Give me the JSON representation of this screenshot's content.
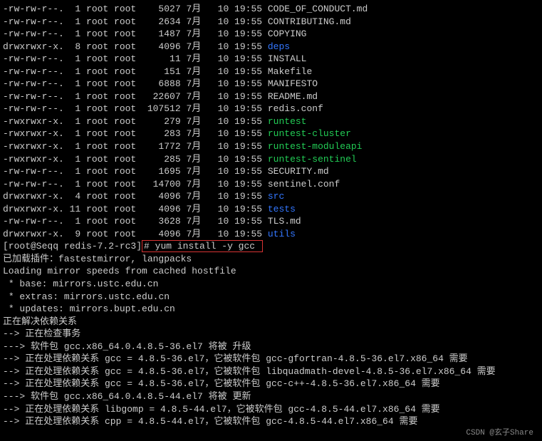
{
  "ls": [
    {
      "perm": "-rw-rw-r--.",
      "n": "1",
      "u": "root",
      "g": "root",
      "size": "5027",
      "mo": "7月",
      "d": "10",
      "t": "19:55",
      "name": "CODE_OF_CONDUCT.md",
      "cls": ""
    },
    {
      "perm": "-rw-rw-r--.",
      "n": "1",
      "u": "root",
      "g": "root",
      "size": "2634",
      "mo": "7月",
      "d": "10",
      "t": "19:55",
      "name": "CONTRIBUTING.md",
      "cls": ""
    },
    {
      "perm": "-rw-rw-r--.",
      "n": "1",
      "u": "root",
      "g": "root",
      "size": "1487",
      "mo": "7月",
      "d": "10",
      "t": "19:55",
      "name": "COPYING",
      "cls": ""
    },
    {
      "perm": "drwxrwxr-x.",
      "n": "8",
      "u": "root",
      "g": "root",
      "size": "4096",
      "mo": "7月",
      "d": "10",
      "t": "19:55",
      "name": "deps",
      "cls": "blue"
    },
    {
      "perm": "-rw-rw-r--.",
      "n": "1",
      "u": "root",
      "g": "root",
      "size": "11",
      "mo": "7月",
      "d": "10",
      "t": "19:55",
      "name": "INSTALL",
      "cls": ""
    },
    {
      "perm": "-rw-rw-r--.",
      "n": "1",
      "u": "root",
      "g": "root",
      "size": "151",
      "mo": "7月",
      "d": "10",
      "t": "19:55",
      "name": "Makefile",
      "cls": ""
    },
    {
      "perm": "-rw-rw-r--.",
      "n": "1",
      "u": "root",
      "g": "root",
      "size": "6888",
      "mo": "7月",
      "d": "10",
      "t": "19:55",
      "name": "MANIFESTO",
      "cls": ""
    },
    {
      "perm": "-rw-rw-r--.",
      "n": "1",
      "u": "root",
      "g": "root",
      "size": "22607",
      "mo": "7月",
      "d": "10",
      "t": "19:55",
      "name": "README.md",
      "cls": ""
    },
    {
      "perm": "-rw-rw-r--.",
      "n": "1",
      "u": "root",
      "g": "root",
      "size": "107512",
      "mo": "7月",
      "d": "10",
      "t": "19:55",
      "name": "redis.conf",
      "cls": ""
    },
    {
      "perm": "-rwxrwxr-x.",
      "n": "1",
      "u": "root",
      "g": "root",
      "size": "279",
      "mo": "7月",
      "d": "10",
      "t": "19:55",
      "name": "runtest",
      "cls": "green"
    },
    {
      "perm": "-rwxrwxr-x.",
      "n": "1",
      "u": "root",
      "g": "root",
      "size": "283",
      "mo": "7月",
      "d": "10",
      "t": "19:55",
      "name": "runtest-cluster",
      "cls": "green"
    },
    {
      "perm": "-rwxrwxr-x.",
      "n": "1",
      "u": "root",
      "g": "root",
      "size": "1772",
      "mo": "7月",
      "d": "10",
      "t": "19:55",
      "name": "runtest-moduleapi",
      "cls": "green"
    },
    {
      "perm": "-rwxrwxr-x.",
      "n": "1",
      "u": "root",
      "g": "root",
      "size": "285",
      "mo": "7月",
      "d": "10",
      "t": "19:55",
      "name": "runtest-sentinel",
      "cls": "green"
    },
    {
      "perm": "-rw-rw-r--.",
      "n": "1",
      "u": "root",
      "g": "root",
      "size": "1695",
      "mo": "7月",
      "d": "10",
      "t": "19:55",
      "name": "SECURITY.md",
      "cls": ""
    },
    {
      "perm": "-rw-rw-r--.",
      "n": "1",
      "u": "root",
      "g": "root",
      "size": "14700",
      "mo": "7月",
      "d": "10",
      "t": "19:55",
      "name": "sentinel.conf",
      "cls": ""
    },
    {
      "perm": "drwxrwxr-x.",
      "n": "4",
      "u": "root",
      "g": "root",
      "size": "4096",
      "mo": "7月",
      "d": "10",
      "t": "19:55",
      "name": "src",
      "cls": "blue"
    },
    {
      "perm": "drwxrwxr-x.",
      "n": "11",
      "u": "root",
      "g": "root",
      "size": "4096",
      "mo": "7月",
      "d": "10",
      "t": "19:55",
      "name": "tests",
      "cls": "blue"
    },
    {
      "perm": "-rw-rw-r--.",
      "n": "1",
      "u": "root",
      "g": "root",
      "size": "3628",
      "mo": "7月",
      "d": "10",
      "t": "19:55",
      "name": "TLS.md",
      "cls": ""
    },
    {
      "perm": "drwxrwxr-x.",
      "n": "9",
      "u": "root",
      "g": "root",
      "size": "4096",
      "mo": "7月",
      "d": "10",
      "t": "19:55",
      "name": "utils",
      "cls": "blue"
    }
  ],
  "prompt": {
    "text": "[root@Seqq redis-7.2-rc3]",
    "cmd": "# yum install -y gcc "
  },
  "yum_lines": [
    "已加载插件：fastestmirror, langpacks",
    "Loading mirror speeds from cached hostfile",
    " * base: mirrors.ustc.edu.cn",
    " * extras: mirrors.ustc.edu.cn",
    " * updates: mirrors.bupt.edu.cn",
    "正在解决依赖关系",
    "--> 正在检查事务",
    "---> 软件包 gcc.x86_64.0.4.8.5-36.el7 将被 升级",
    "--> 正在处理依赖关系 gcc = 4.8.5-36.el7，它被软件包 gcc-gfortran-4.8.5-36.el7.x86_64 需要",
    "--> 正在处理依赖关系 gcc = 4.8.5-36.el7，它被软件包 libquadmath-devel-4.8.5-36.el7.x86_64 需要",
    "--> 正在处理依赖关系 gcc = 4.8.5-36.el7，它被软件包 gcc-c++-4.8.5-36.el7.x86_64 需要",
    "---> 软件包 gcc.x86_64.0.4.8.5-44.el7 将被 更新",
    "--> 正在处理依赖关系 libgomp = 4.8.5-44.el7，它被软件包 gcc-4.8.5-44.el7.x86_64 需要",
    "--> 正在处理依赖关系 cpp = 4.8.5-44.el7，它被软件包 gcc-4.8.5-44.el7.x86_64 需要"
  ],
  "watermark": "CSDN @玄子Share"
}
